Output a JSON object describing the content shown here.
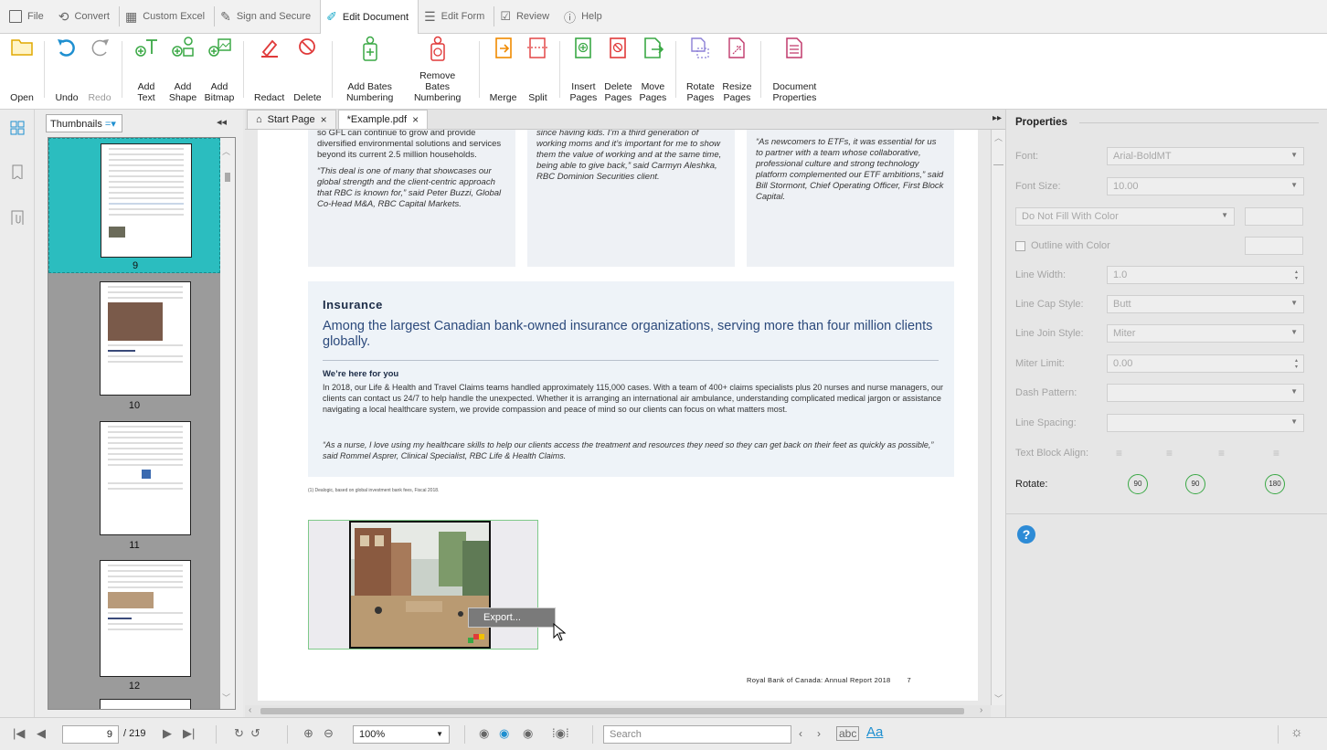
{
  "menu": {
    "items": [
      {
        "label": "File",
        "icon": "file-icon"
      },
      {
        "label": "Convert",
        "icon": "convert-icon"
      },
      {
        "label": "Custom Excel",
        "icon": "table-icon"
      },
      {
        "label": "Sign and Secure",
        "icon": "pen-icon"
      },
      {
        "label": "Edit Document",
        "icon": "edit-document-icon",
        "active": true
      },
      {
        "label": "Edit Form",
        "icon": "form-icon"
      },
      {
        "label": "Review",
        "icon": "review-icon"
      },
      {
        "label": "Help",
        "icon": "help-icon"
      }
    ]
  },
  "ribbon": {
    "open": "Open",
    "undo": "Undo",
    "redo": "Redo",
    "add_text": "Add Text",
    "add_shape": "Add Shape",
    "add_bitmap": "Add Bitmap",
    "redact": "Redact",
    "delete": "Delete",
    "add_bates": "Add Bates Numbering",
    "remove_bates": "Remove Bates Numbering",
    "merge": "Merge",
    "split": "Split",
    "insert_pages": "Insert Pages",
    "delete_pages": "Delete Pages",
    "move_pages": "Move Pages",
    "rotate_pages": "Rotate Pages",
    "resize_pages": "Resize Pages",
    "document_properties": "Document Properties"
  },
  "thumbnails": {
    "dropdown": "Thumbnails",
    "collapse": "◂◂",
    "pages": [
      "9",
      "10",
      "11",
      "12"
    ],
    "selected": "9"
  },
  "tabs": {
    "start": "Start Page",
    "doc": "*Example.pdf"
  },
  "document": {
    "col1_a": "so GFL can continue to grow and provide diversified environmental solutions and services beyond its current 2.5 million households.",
    "col1_b": "“This deal is one of many that showcases our global strength and the client-centric approach that RBC is known for,” said Peter Buzzi, Global Co-Head M&A, RBC Capital Markets.",
    "col2": "since having kids. I’m a third generation of working moms and it’s important for me to show them the value of working and at the same time, being able to give back,” said Carmyn Aleshka, RBC Dominion Securities client.",
    "col3": "“As newcomers to ETFs, it was essential for us to partner with a team whose collaborative, professional culture and strong technology platform complemented our ETF ambitions,” said Bill Stormont, Chief Operating Officer, First Block Capital.",
    "insurance_title": "Insurance",
    "insurance_lead": "Among the largest Canadian bank-owned insurance organizations, serving more than four million clients globally.",
    "here_title": "We’re here for you",
    "here_body": "In 2018, our Life & Health and Travel Claims teams handled approximately 115,000 cases. With a team of 400+ claims specialists plus 20 nurses and nurse managers, our clients can contact us 24/7 to help handle the unexpected. Whether it is arranging an international air ambulance, understanding complicated medical jargon or assistance navigating a local healthcare system, we provide compassion and peace of mind so our clients can focus on what matters most.",
    "here_quote": "“As a nurse, I love using my healthcare skills to help our clients access the treatment and resources they need so they can get back on their feet as quickly as possible,” said Rommel Asprer, Clinical Specialist, RBC Life & Health Claims.",
    "footnote": "(1)  Dealogic, based on global investment bank fees, Fiscal 2018.",
    "running_footer": "Royal Bank of Canada: Annual Report 2018",
    "page_number": "7",
    "context_menu": "Export..."
  },
  "properties": {
    "title": "Properties",
    "font_label": "Font:",
    "font_value": "Arial-BoldMT",
    "font_size_label": "Font Size:",
    "font_size_value": "10.00",
    "fill_value": "Do Not Fill With Color",
    "outline_label": "Outline with Color",
    "line_width_label": "Line Width:",
    "line_width_value": "1.0",
    "line_cap_label": "Line Cap Style:",
    "line_cap_value": "Butt",
    "line_join_label": "Line Join Style:",
    "line_join_value": "Miter",
    "miter_label": "Miter Limit:",
    "miter_value": "0.00",
    "dash_label": "Dash Pattern:",
    "spacing_label": "Line Spacing:",
    "align_label": "Text Block Align:",
    "rotate_label": "Rotate:",
    "rotate_values": [
      "90",
      "90",
      "180"
    ]
  },
  "status": {
    "page": "9",
    "total": "/ 219",
    "zoom": "100%",
    "search_placeholder": "Search",
    "abc": "abc",
    "case": "Aa"
  },
  "colors": {
    "accent": "#2bbdbf",
    "selection_green": "#3aa845",
    "title_navy": "#1c2c47"
  }
}
